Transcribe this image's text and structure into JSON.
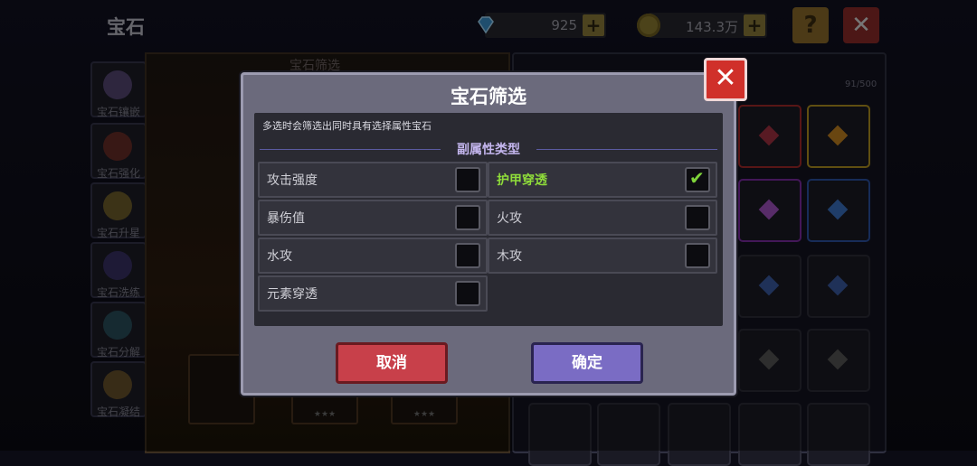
{
  "header": {
    "title": "宝石",
    "diamonds": "925",
    "gold": "143.3万",
    "help_label": "?",
    "close_label": "✕"
  },
  "nav": [
    {
      "label": "宝石镶嵌"
    },
    {
      "label": "宝石强化"
    },
    {
      "label": "宝石升星"
    },
    {
      "label": "宝石洗练"
    },
    {
      "label": "宝石分解"
    },
    {
      "label": "宝石凝结"
    }
  ],
  "background": {
    "center_title": "宝石筛选",
    "count": "91/500",
    "stars": "★★★"
  },
  "modal": {
    "title": "宝石筛选",
    "hint": "多选时会筛选出同时具有选择属性宝石",
    "section": "副属性类型",
    "options": [
      {
        "label": "攻击强度",
        "checked": false
      },
      {
        "label": "护甲穿透",
        "checked": true
      },
      {
        "label": "暴伤值",
        "checked": false
      },
      {
        "label": "火攻",
        "checked": false
      },
      {
        "label": "水攻",
        "checked": false
      },
      {
        "label": "木攻",
        "checked": false
      },
      {
        "label": "元素穿透",
        "checked": false
      }
    ],
    "check_mark": "✔",
    "cancel_label": "取消",
    "confirm_label": "确定",
    "close_label": "✕"
  },
  "colors": {
    "accent_green": "#8fdc3a",
    "cancel_red": "#c8404a",
    "confirm_purple": "#7a6cc4",
    "close_red": "#d0302a"
  }
}
